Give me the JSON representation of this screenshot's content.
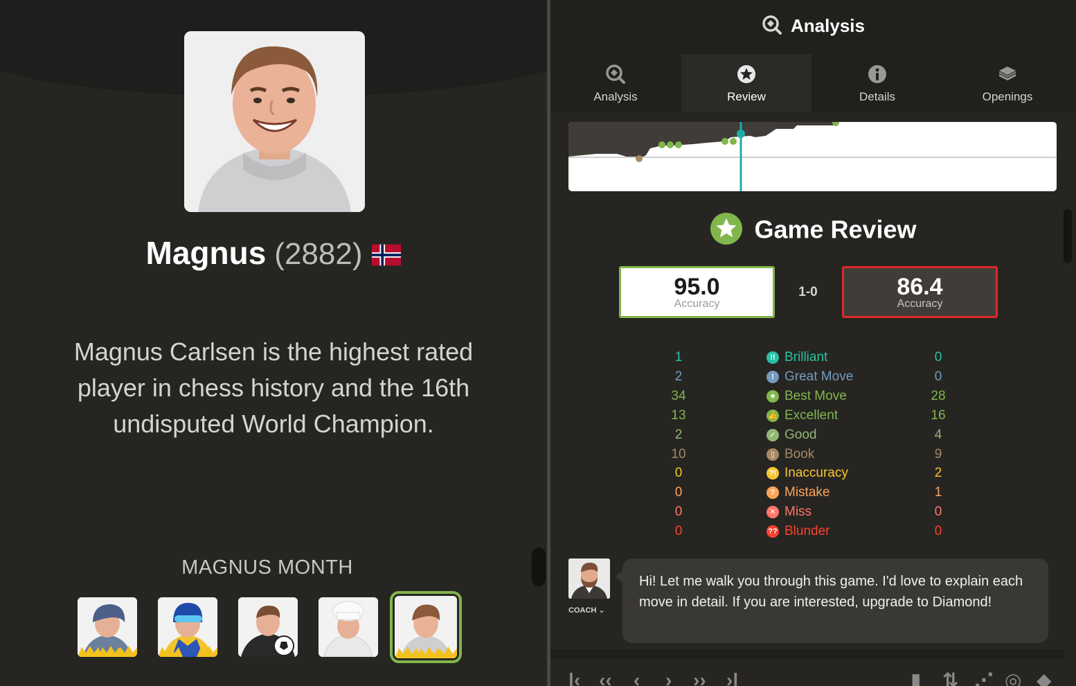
{
  "profile": {
    "name": "Magnus",
    "rating": "(2882)",
    "bio": "Magnus Carlsen is the highest rated player in chess history and the 16th undisputed World Champion.",
    "month_title": "MAGNUS MONTH"
  },
  "header": {
    "title": "Analysis"
  },
  "tabs": [
    {
      "label": "Analysis",
      "icon": "magnifier-icon"
    },
    {
      "label": "Review",
      "icon": "star-icon"
    },
    {
      "label": "Details",
      "icon": "info-icon"
    },
    {
      "label": "Openings",
      "icon": "book-icon"
    }
  ],
  "review": {
    "title": "Game Review",
    "white_accuracy": "95.0",
    "black_accuracy": "86.4",
    "accuracy_label": "Accuracy",
    "result": "1-0"
  },
  "classifications": [
    {
      "label": "Brilliant",
      "white": "1",
      "black": "0",
      "color": "#26c2a3",
      "glyph": "!!"
    },
    {
      "label": "Great Move",
      "white": "2",
      "black": "0",
      "color": "#749bbf",
      "glyph": "!"
    },
    {
      "label": "Best Move",
      "white": "34",
      "black": "28",
      "color": "#81b64c",
      "glyph": "★"
    },
    {
      "label": "Excellent",
      "white": "13",
      "black": "16",
      "color": "#81b64c",
      "glyph": "👍"
    },
    {
      "label": "Good",
      "white": "2",
      "black": "4",
      "color": "#95b776",
      "glyph": "✓"
    },
    {
      "label": "Book",
      "white": "10",
      "black": "9",
      "color": "#a88865",
      "glyph": "▯"
    },
    {
      "label": "Inaccuracy",
      "white": "0",
      "black": "2",
      "color": "#f7c631",
      "glyph": "?!"
    },
    {
      "label": "Mistake",
      "white": "0",
      "black": "1",
      "color": "#ffa459",
      "glyph": "?"
    },
    {
      "label": "Miss",
      "white": "0",
      "black": "0",
      "color": "#ff7769",
      "glyph": "✕"
    },
    {
      "label": "Blunder",
      "white": "0",
      "black": "0",
      "color": "#fa412d",
      "glyph": "??"
    }
  ],
  "coach": {
    "label": "COACH ⌄",
    "message": "Hi! Let me walk you through this game. I'd love to explain each move in detail. If you are interested, upgrade to Diamond!"
  },
  "colors": {
    "accent_green": "#81b64c",
    "accent_red": "#e02828",
    "current_move_marker": "#1baca6"
  }
}
